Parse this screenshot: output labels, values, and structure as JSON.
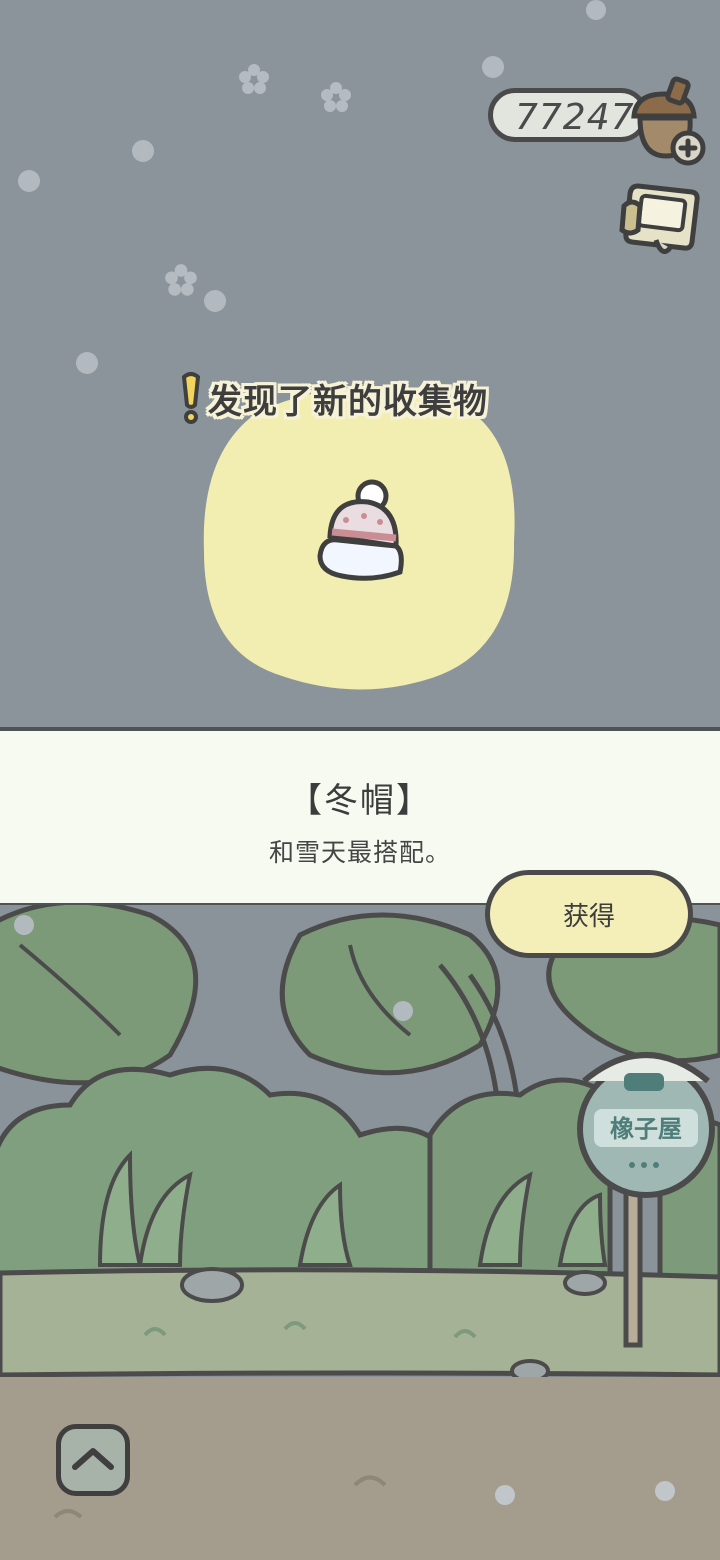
{
  "hud": {
    "acorn_count": "77247",
    "acorn_icon": "acorn-add-icon",
    "album_icon": "album-icon"
  },
  "discovery": {
    "notice": "发现了新的收集物",
    "item_icon": "winter-hat-icon"
  },
  "item": {
    "name": "【冬帽】",
    "description": "和雪天最搭配。"
  },
  "actions": {
    "obtain_label": "获得",
    "expand_icon": "chevron-up-icon"
  },
  "colors": {
    "sky": "#8b949b",
    "glow": "#f2edb0",
    "panel": "#f6faf0",
    "button": "#f4efb9",
    "foliage": "#7f9c7c",
    "ground": "#a59d8e"
  }
}
